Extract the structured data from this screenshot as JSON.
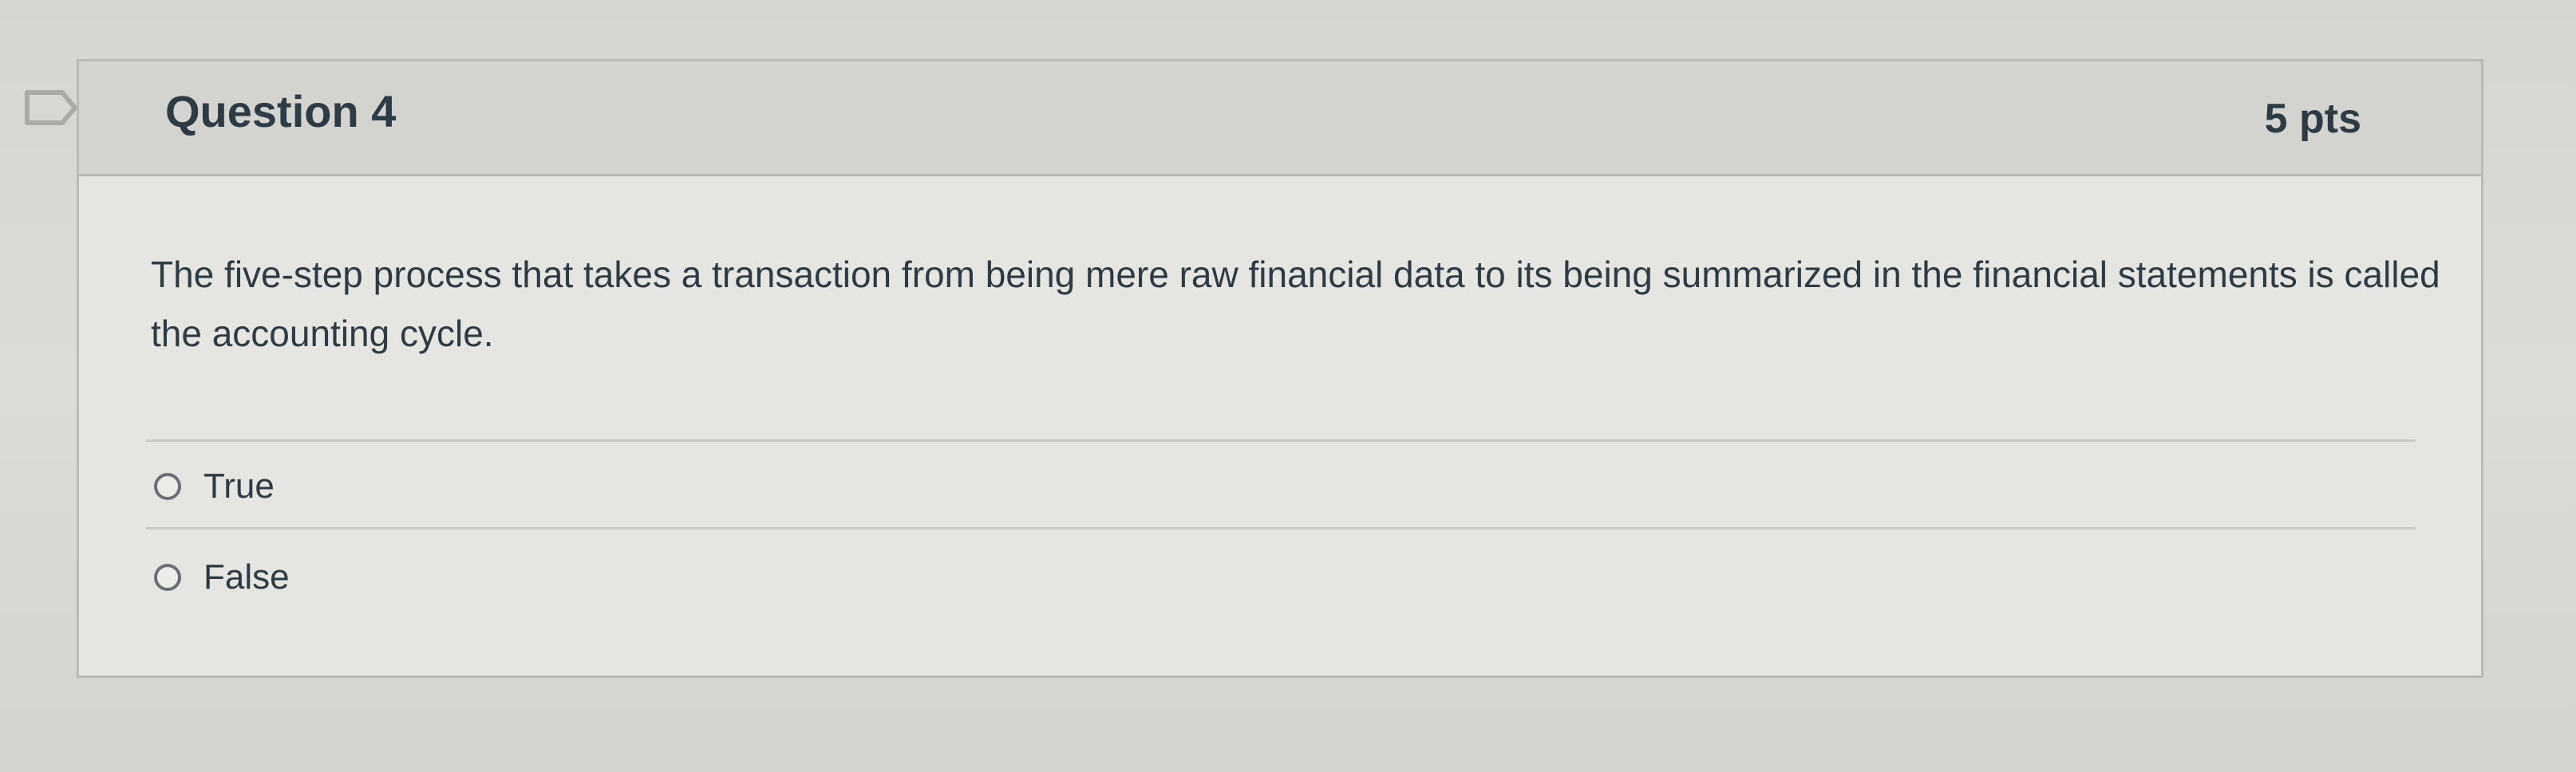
{
  "question": {
    "title": "Question 4",
    "points": "5 pts",
    "text": "The five-step process that takes a transaction from being mere raw financial data to its being summarized in the financial statements is called the accounting cycle.",
    "flag_icon": "flag-icon"
  },
  "answers": [
    {
      "label": "True",
      "selected": false
    },
    {
      "label": "False",
      "selected": false
    }
  ]
}
